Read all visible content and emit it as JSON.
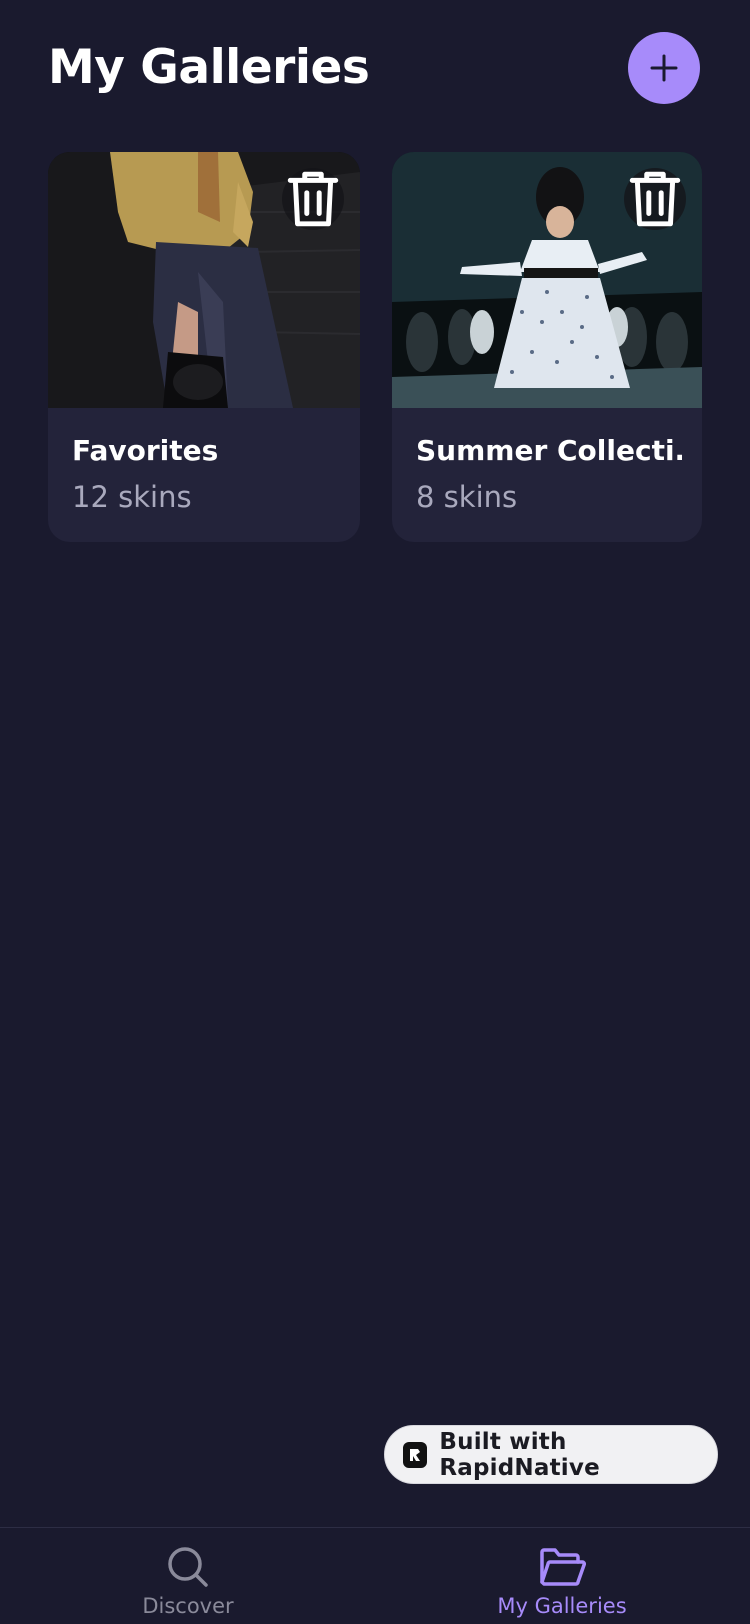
{
  "header": {
    "title": "My Galleries"
  },
  "galleries": [
    {
      "title": "Favorites",
      "count": "12 skins"
    },
    {
      "title": "Summer Collecti...",
      "count": "8 skins"
    }
  ],
  "badge": {
    "label": "Built with RapidNative"
  },
  "tabbar": {
    "tabs": [
      {
        "label": "Discover",
        "active": false
      },
      {
        "label": "My Galleries",
        "active": true
      }
    ]
  },
  "colors": {
    "background": "#1a1a2e",
    "card": "#23233a",
    "accent": "#a78bfa",
    "muted_text": "#a9a9bd"
  },
  "icons": {
    "add": "plus-icon",
    "delete": "trash-icon",
    "discover": "search-icon",
    "galleries": "folder-open-icon",
    "badge": "rapidnative-logo-icon"
  }
}
